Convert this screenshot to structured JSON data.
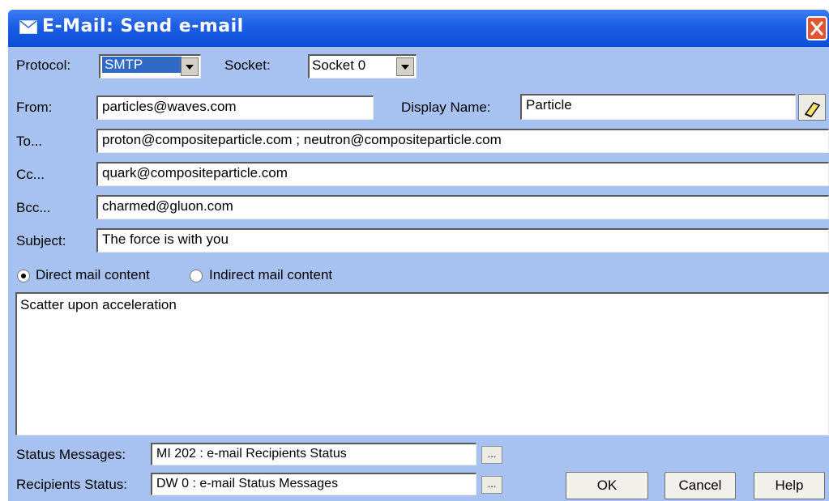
{
  "window": {
    "title": "E-Mail: Send e-mail"
  },
  "protocol": {
    "label": "Protocol:",
    "value": "SMTP"
  },
  "socket": {
    "label": "Socket:",
    "value": "Socket 0"
  },
  "from": {
    "label": "From:",
    "value": "particles@waves.com"
  },
  "display_name": {
    "label": "Display Name:",
    "value": "Particle"
  },
  "to": {
    "label": "To...",
    "value": "proton@compositeparticle.com ; neutron@compositeparticle.com"
  },
  "cc": {
    "label": "Cc...",
    "value": "quark@compositeparticle.com"
  },
  "bcc": {
    "label": "Bcc...",
    "value": "charmed@gluon.com"
  },
  "subject": {
    "label": "Subject:",
    "value": "The force is with you"
  },
  "content_mode": {
    "direct_label": "Direct mail content",
    "indirect_label": "Indirect mail content",
    "selected": "direct"
  },
  "body_text": "Scatter upon acceleration",
  "status_messages": {
    "label": "Status Messages:",
    "value": "MI 202 : e-mail Recipients Status",
    "browse": "..."
  },
  "recipients_status": {
    "label": "Recipients Status:",
    "value": "DW 0 : e-mail Status Messages",
    "browse": "..."
  },
  "buttons": {
    "ok": "OK",
    "cancel": "Cancel",
    "help": "Help"
  },
  "icons": {
    "title": "envelope-icon",
    "close": "close-icon",
    "clear": "eraser-icon"
  },
  "colors": {
    "titlebar": "#0c4fd6",
    "client": "#a7c2f0",
    "close": "#e2542e"
  }
}
